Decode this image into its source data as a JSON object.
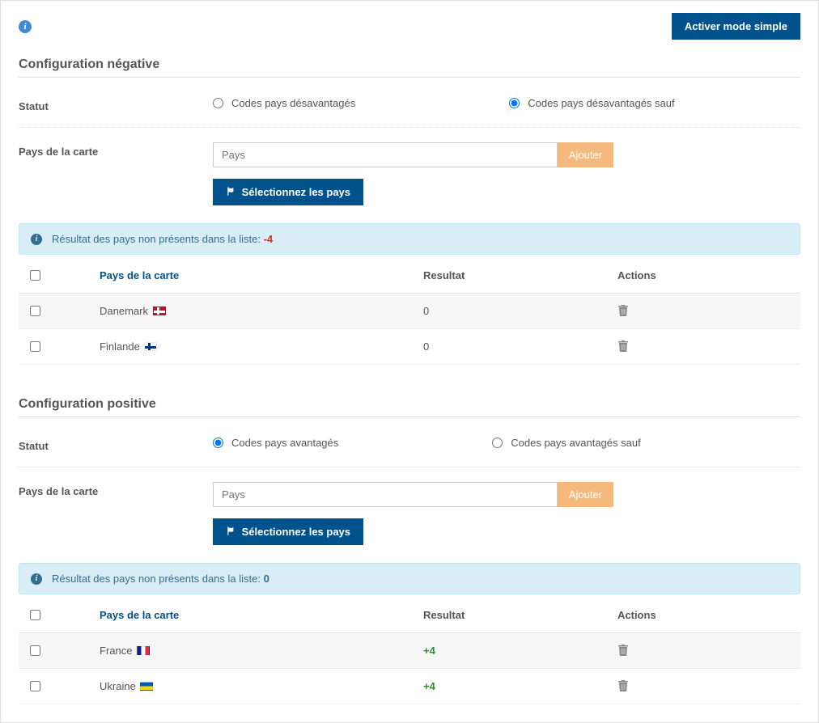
{
  "top": {
    "activate_simple": "Activer mode simple"
  },
  "negative": {
    "title": "Configuration négative",
    "status_label": "Statut",
    "radio1": "Codes pays désavantagés",
    "radio2": "Codes pays désavantagés sauf",
    "country_label": "Pays de la carte",
    "placeholder": "Pays",
    "add_btn": "Ajouter",
    "select_btn": "Sélectionnez les pays",
    "info_text": "Résultat des pays non présents dans la liste: ",
    "info_value": "-4",
    "table": {
      "h_country": "Pays de la carte",
      "h_result": "Resultat",
      "h_actions": "Actions",
      "rows": [
        {
          "country": "Danemark",
          "flag": "dk",
          "result": "0"
        },
        {
          "country": "Finlande",
          "flag": "fi",
          "result": "0"
        }
      ]
    }
  },
  "positive": {
    "title": "Configuration positive",
    "status_label": "Statut",
    "radio1": "Codes pays avantagés",
    "radio2": "Codes pays avantagés sauf",
    "country_label": "Pays de la carte",
    "placeholder": "Pays",
    "add_btn": "Ajouter",
    "select_btn": "Sélectionnez les pays",
    "info_text": "Résultat des pays non présents dans la liste: ",
    "info_value": "0",
    "table": {
      "h_country": "Pays de la carte",
      "h_result": "Resultat",
      "h_actions": "Actions",
      "rows": [
        {
          "country": "France",
          "flag": "fr",
          "result": "+4"
        },
        {
          "country": "Ukraine",
          "flag": "ua",
          "result": "+4"
        }
      ]
    }
  }
}
